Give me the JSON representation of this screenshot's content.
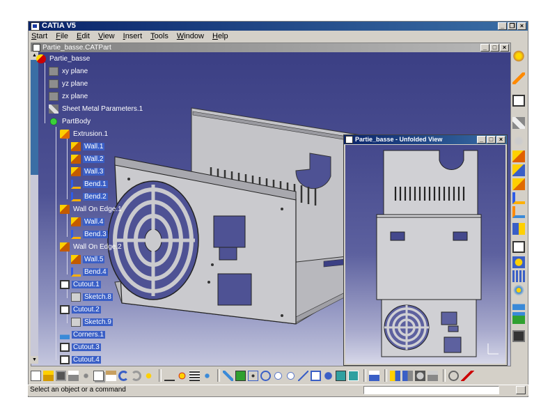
{
  "app": {
    "title": "CATIA V5",
    "menu": [
      "Start",
      "File",
      "Edit",
      "View",
      "Insert",
      "Tools",
      "Window",
      "Help"
    ]
  },
  "document": {
    "title": "Partie_basse.CATPart"
  },
  "tree": {
    "root": "Partie_basse",
    "items": [
      {
        "label": "xy plane",
        "icon": "plane-icon"
      },
      {
        "label": "yz plane",
        "icon": "plane-icon"
      },
      {
        "label": "zx plane",
        "icon": "plane-icon"
      },
      {
        "label": "Sheet Metal Parameters.1",
        "icon": "sheet-metal-icon"
      },
      {
        "label": "PartBody",
        "icon": "partbody-icon"
      },
      {
        "label": "Extrusion.1",
        "icon": "extrusion-icon"
      },
      {
        "label": "Wall.1",
        "icon": "wall-icon"
      },
      {
        "label": "Wall.2",
        "icon": "wall-icon"
      },
      {
        "label": "Wall.3",
        "icon": "wall-icon"
      },
      {
        "label": "Bend.1",
        "icon": "bend-icon"
      },
      {
        "label": "Bend.2",
        "icon": "bend-icon"
      },
      {
        "label": "Wall On Edge.1",
        "icon": "wall-on-edge-icon"
      },
      {
        "label": "Wall.4",
        "icon": "wall-icon"
      },
      {
        "label": "Bend.3",
        "icon": "bend-icon"
      },
      {
        "label": "Wall On Edge.2",
        "icon": "wall-on-edge-icon"
      },
      {
        "label": "Wall.5",
        "icon": "wall-icon"
      },
      {
        "label": "Bend.4",
        "icon": "bend-icon"
      },
      {
        "label": "Cutout.1",
        "icon": "cutout-icon"
      },
      {
        "label": "Sketch.8",
        "icon": "sketch-icon"
      },
      {
        "label": "Cutout.2",
        "icon": "cutout-icon"
      },
      {
        "label": "Sketch.9",
        "icon": "sketch-icon"
      },
      {
        "label": "Corners.1",
        "icon": "corner-icon"
      },
      {
        "label": "Cutout.3",
        "icon": "cutout-icon"
      },
      {
        "label": "Cutout.4",
        "icon": "cutout-icon"
      }
    ]
  },
  "unfolded": {
    "title": "Partie_basse - Unfolded View"
  },
  "status": {
    "message": "Select an object or a command",
    "command_value": ""
  },
  "colors": {
    "titlebar": "#0a246a",
    "selection": "#3a5fc6",
    "viewport_top": "#3b3f84",
    "viewport_bottom": "#c5c7de",
    "part": "#c8c8cc"
  }
}
